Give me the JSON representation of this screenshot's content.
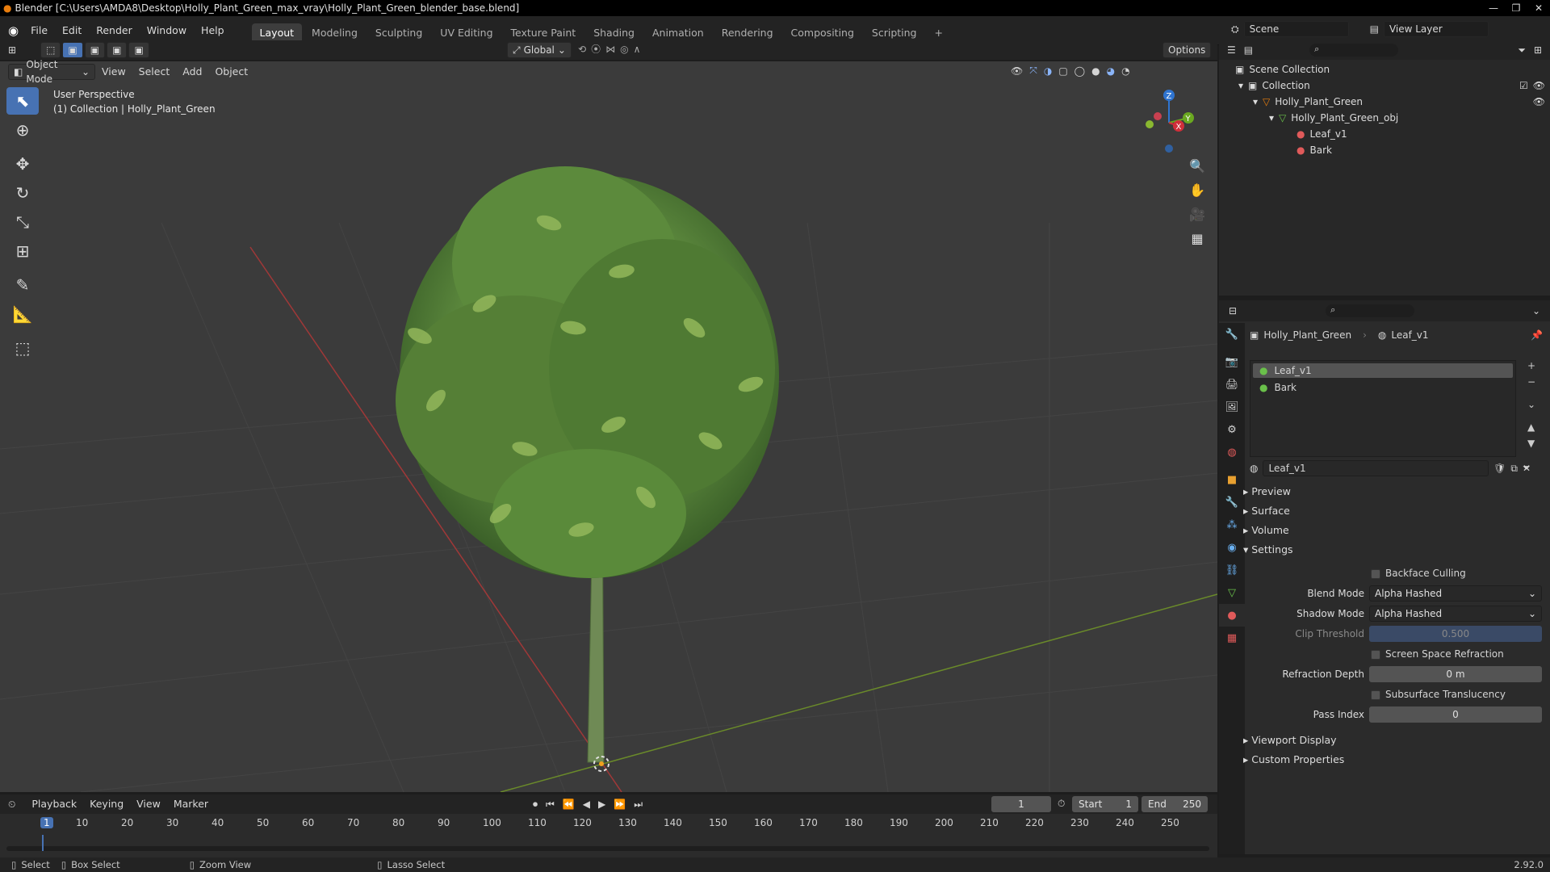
{
  "window": {
    "title": "Blender [C:\\Users\\AMDA8\\Desktop\\Holly_Plant_Green_max_vray\\Holly_Plant_Green_blender_base.blend]"
  },
  "menu": [
    "File",
    "Edit",
    "Render",
    "Window",
    "Help"
  ],
  "workspaces": [
    "Layout",
    "Modeling",
    "Sculpting",
    "UV Editing",
    "Texture Paint",
    "Shading",
    "Animation",
    "Rendering",
    "Compositing",
    "Scripting"
  ],
  "scene": {
    "name": "Scene",
    "view_layer": "View Layer"
  },
  "viewport_header": {
    "orientation": "Global",
    "options": "Options",
    "mode": "Object Mode",
    "menus": [
      "View",
      "Select",
      "Add",
      "Object"
    ]
  },
  "viewport": {
    "perspective": "User Perspective",
    "collection_info": "(1) Collection | Holly_Plant_Green"
  },
  "gizmo": {
    "z": "Z",
    "y": "Y",
    "x": "X"
  },
  "outliner": {
    "rows": [
      {
        "label": "Scene Collection"
      },
      {
        "label": "Collection"
      },
      {
        "label": "Holly_Plant_Green"
      },
      {
        "label": "Holly_Plant_Green_obj"
      },
      {
        "label": "Leaf_v1"
      },
      {
        "label": "Bark"
      }
    ]
  },
  "properties": {
    "breadcrumb_object": "Holly_Plant_Green",
    "breadcrumb_material": "Leaf_v1",
    "slots": [
      "Leaf_v1",
      "Bark"
    ],
    "material_name": "Leaf_v1",
    "panels": [
      "Preview",
      "Surface",
      "Volume",
      "Settings",
      "Viewport Display",
      "Custom Properties"
    ],
    "settings": {
      "backface_culling": "Backface Culling",
      "blend_mode_label": "Blend Mode",
      "blend_mode": "Alpha Hashed",
      "shadow_mode_label": "Shadow Mode",
      "shadow_mode": "Alpha Hashed",
      "clip_threshold_label": "Clip Threshold",
      "clip_threshold": "0.500",
      "ssr_label": "Screen Space Refraction",
      "refraction_depth_label": "Refraction Depth",
      "refraction_depth": "0 m",
      "sss_label": "Subsurface Translucency",
      "pass_index_label": "Pass Index",
      "pass_index": "0"
    }
  },
  "timeline": {
    "menus": [
      "Playback",
      "Keying",
      "View",
      "Marker"
    ],
    "current_frame": "1",
    "start_label": "Start",
    "start": "1",
    "end_label": "End",
    "end": "250",
    "ruler": [
      "1",
      "10",
      "20",
      "30",
      "40",
      "50",
      "60",
      "70",
      "80",
      "90",
      "100",
      "110",
      "120",
      "130",
      "140",
      "150",
      "160",
      "170",
      "180",
      "190",
      "200",
      "210",
      "220",
      "230",
      "240",
      "250"
    ]
  },
  "statusbar": {
    "select": "Select",
    "box_select": "Box Select",
    "zoom_view": "Zoom View",
    "lasso_select": "Lasso Select",
    "version": "2.92.0"
  },
  "colors": {
    "accent": "#4772b3",
    "leaf_dark": "#3e6b2e",
    "leaf_light": "#8fb55a",
    "stem": "#6f8a55"
  }
}
